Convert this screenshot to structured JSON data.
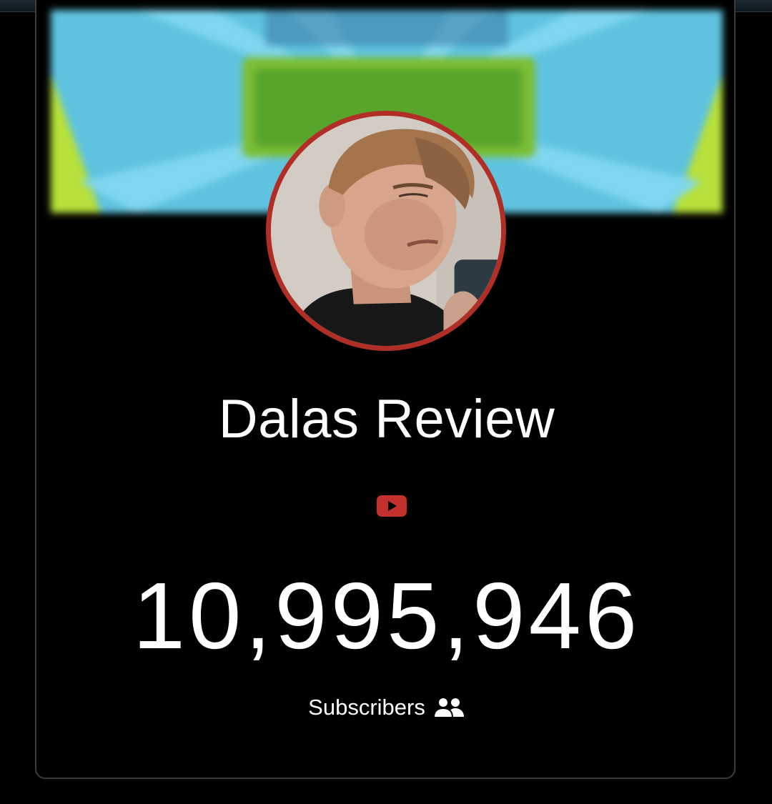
{
  "channel": {
    "name": "Dalas Review",
    "platform_icon": "youtube-icon",
    "subscriber_count": "10,995,946",
    "subscribers_label": "Subscribers",
    "subscribers_icon": "users-icon"
  },
  "colors": {
    "accent": "#b12e26",
    "background": "#000000",
    "banner_blue": "#5fc3e0",
    "banner_green": "#b7e03a"
  }
}
